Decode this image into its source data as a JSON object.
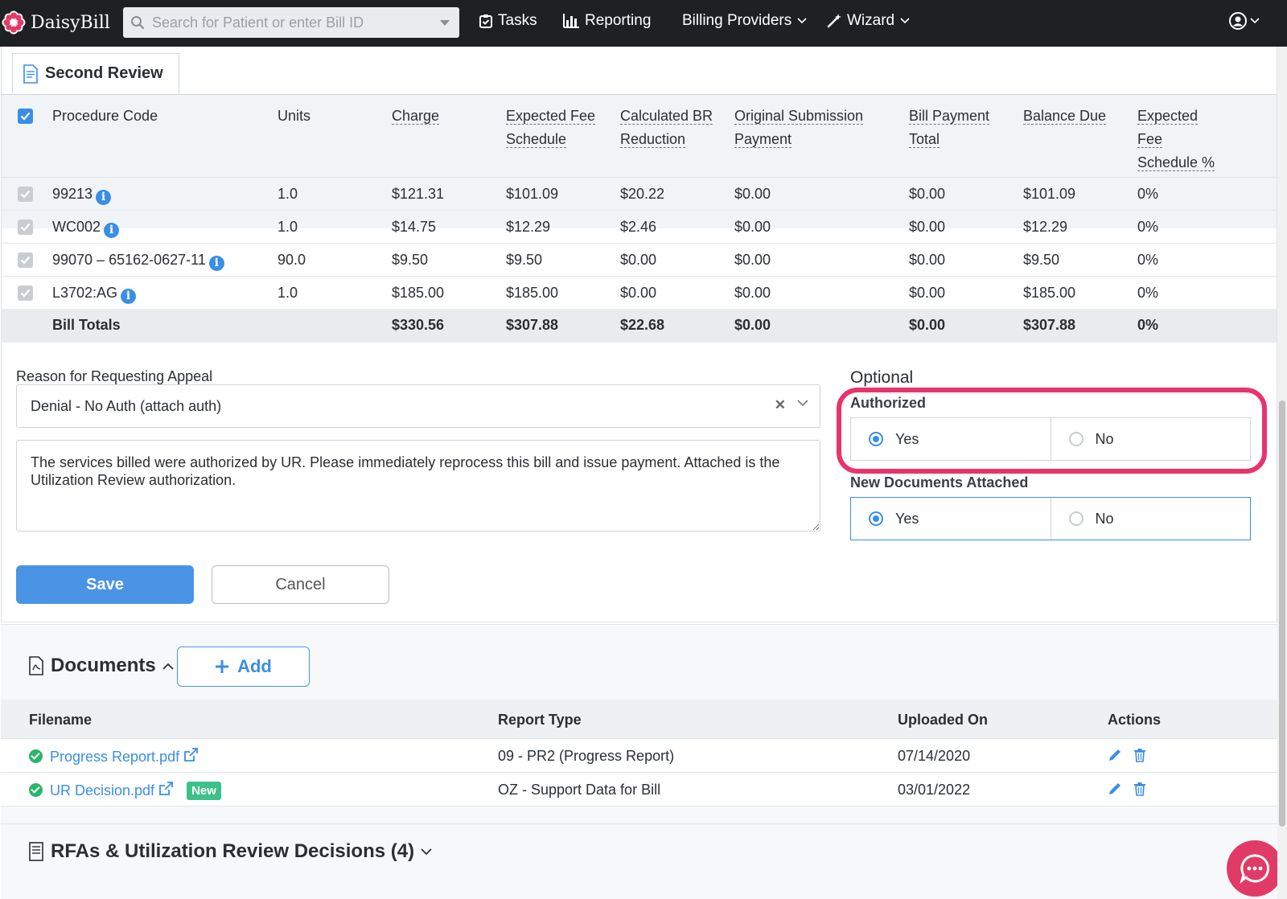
{
  "nav": {
    "brand": "DaisyBill",
    "search_placeholder": "Search for Patient or enter Bill ID",
    "tasks": "Tasks",
    "reporting": "Reporting",
    "billing_providers": "Billing Providers",
    "wizard": "Wizard"
  },
  "review": {
    "tab_label": "Second Review",
    "columns": {
      "procedure_code": "Procedure Code",
      "units": "Units",
      "charge": "Charge",
      "expected_fee_1": "Expected Fee",
      "expected_fee_2": "Schedule",
      "calc_br_1": "Calculated BR",
      "calc_br_2": "Reduction",
      "orig_sub_1": "Original Submission",
      "orig_sub_2": "Payment",
      "bill_pay_1": "Bill Payment",
      "bill_pay_2": "Total",
      "balance_due": "Balance Due",
      "efs_pct_1": "Expected",
      "efs_pct_2": "Fee",
      "efs_pct_3": "Schedule %"
    },
    "rows": [
      {
        "code": "99213",
        "units": "1.0",
        "charge": "$121.31",
        "expected": "$101.09",
        "reduction": "$20.22",
        "original": "$0.00",
        "payment": "$0.00",
        "balance": "$101.09",
        "pct": "0%"
      },
      {
        "code": "WC002",
        "units": "1.0",
        "charge": "$14.75",
        "expected": "$12.29",
        "reduction": "$2.46",
        "original": "$0.00",
        "payment": "$0.00",
        "balance": "$12.29",
        "pct": "0%"
      },
      {
        "code": "99070 – 65162-0627-11",
        "units": "90.0",
        "charge": "$9.50",
        "expected": "$9.50",
        "reduction": "$0.00",
        "original": "$0.00",
        "payment": "$0.00",
        "balance": "$9.50",
        "pct": "0%"
      },
      {
        "code": "L3702:AG",
        "units": "1.0",
        "charge": "$185.00",
        "expected": "$185.00",
        "reduction": "$0.00",
        "original": "$0.00",
        "payment": "$0.00",
        "balance": "$185.00",
        "pct": "0%"
      }
    ],
    "totals": {
      "label": "Bill Totals",
      "charge": "$330.56",
      "expected": "$307.88",
      "reduction": "$22.68",
      "original": "$0.00",
      "payment": "$0.00",
      "balance": "$307.88",
      "pct": "0%"
    }
  },
  "appeal": {
    "reason_label": "Reason for Requesting Appeal",
    "reason_value": "Denial - No Auth (attach auth)",
    "notes": "The services billed were authorized by UR. Please immediately reprocess this bill and issue payment. Attached is the Utilization Review authorization.",
    "optional_label": "Optional",
    "authorized_label": "Authorized",
    "authorized_yes": "Yes",
    "authorized_no": "No",
    "authorized_value": "Yes",
    "new_docs_label": "New Documents Attached",
    "new_docs_yes": "Yes",
    "new_docs_no": "No",
    "new_docs_value": "Yes",
    "save": "Save",
    "cancel": "Cancel",
    "highlight_color": "#e8336d"
  },
  "documents": {
    "title": "Documents",
    "add": "Add",
    "columns": {
      "filename": "Filename",
      "report_type": "Report Type",
      "uploaded_on": "Uploaded On",
      "actions": "Actions"
    },
    "rows": [
      {
        "filename": "Progress Report.pdf",
        "report_type": "09 - PR2 (Progress Report)",
        "uploaded_on": "07/14/2020",
        "badge": ""
      },
      {
        "filename": "UR Decision.pdf",
        "report_type": "OZ - Support Data for Bill",
        "uploaded_on": "03/01/2022",
        "badge": "New"
      }
    ]
  },
  "rfa": {
    "title": "RFAs & Utilization Review Decisions (4)"
  }
}
